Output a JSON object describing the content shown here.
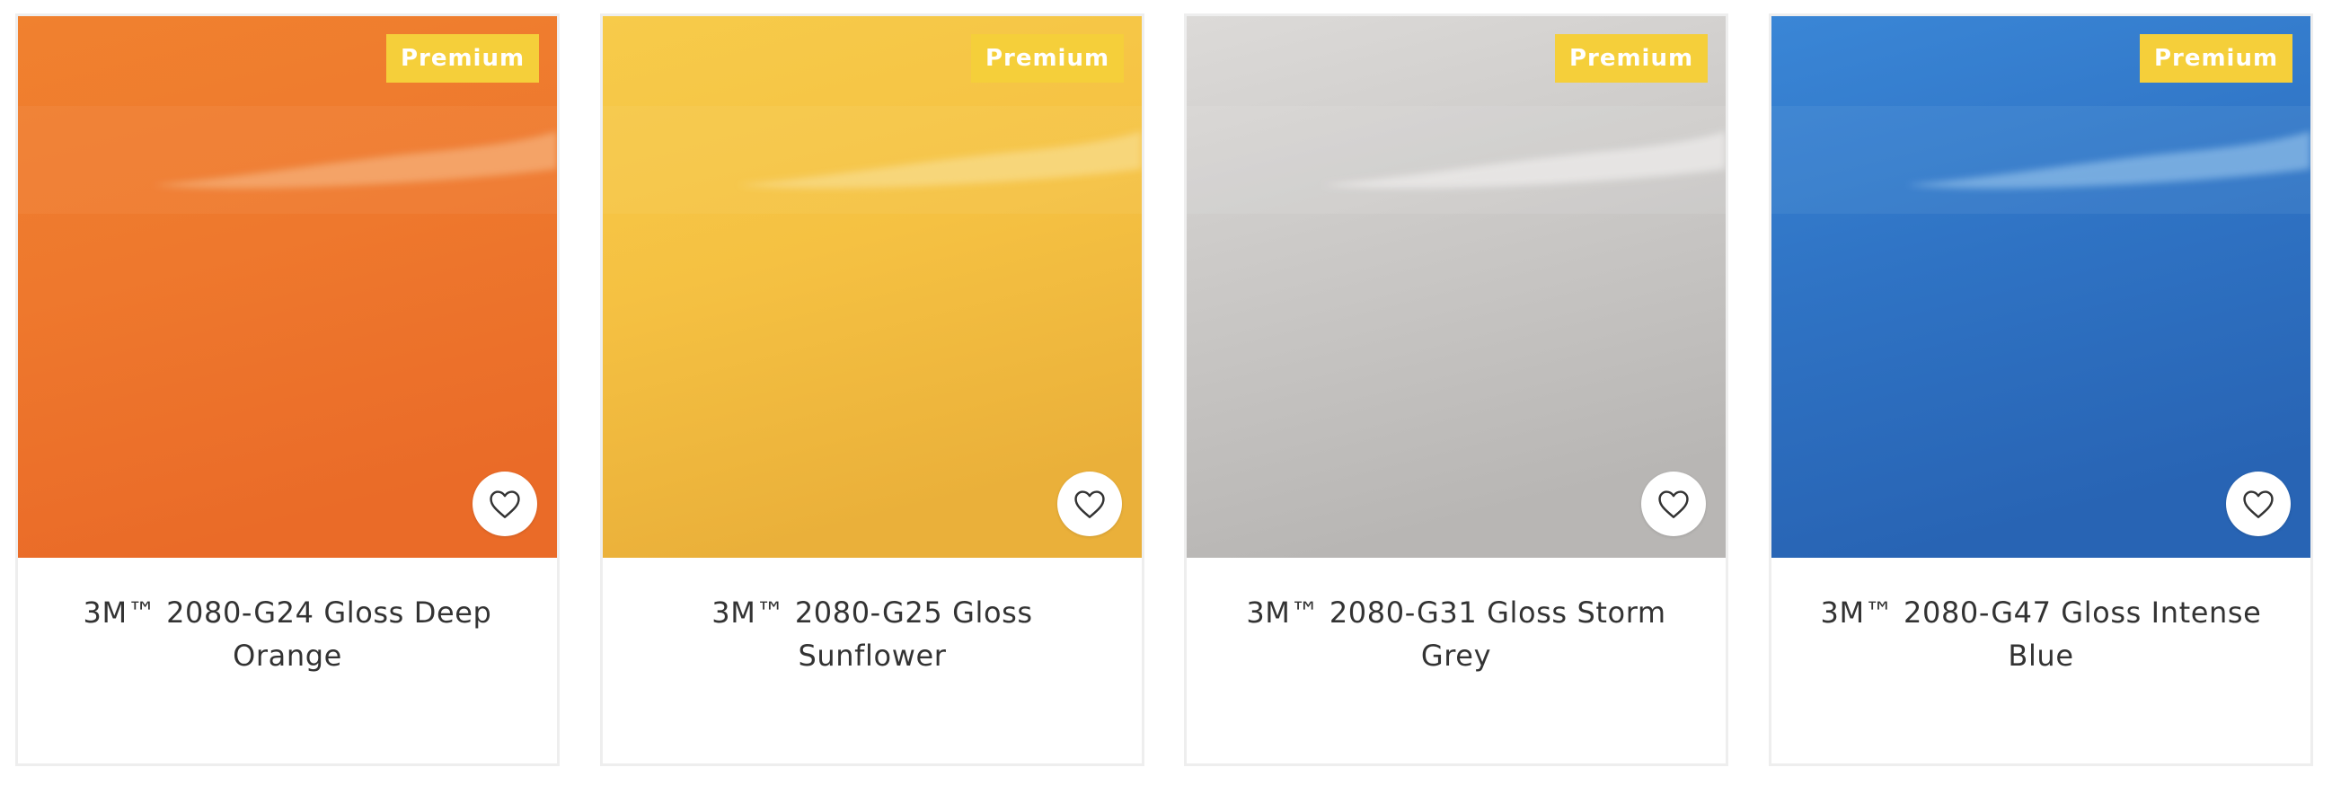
{
  "products": [
    {
      "badge": "Premium",
      "title": "3M™ 2080-G24 Gloss Deep Orange",
      "swatch": {
        "top": "#f0812f",
        "mid": "#ee782d",
        "bottom": "#ea6b28",
        "streak": "#f6b078"
      },
      "favorite_icon": "heart-outline-icon"
    },
    {
      "badge": "Premium",
      "title": "3M™ 2080-G25 Gloss Sunflower",
      "swatch": {
        "top": "#f7cb4a",
        "mid": "#f5c142",
        "bottom": "#eab03a",
        "streak": "#f9dc8a"
      },
      "favorite_icon": "heart-outline-icon"
    },
    {
      "badge": "Premium",
      "title": "3M™ 2080-G31 Gloss Storm Grey",
      "swatch": {
        "top": "#dcdad8",
        "mid": "#cac8c6",
        "bottom": "#b8b6b4",
        "streak": "#eeeceb"
      },
      "favorite_icon": "heart-outline-icon"
    },
    {
      "badge": "Premium",
      "title": "3M™ 2080-G47 Gloss Intense Blue",
      "swatch": {
        "top": "#3a86d6",
        "mid": "#2f73c4",
        "bottom": "#2864b4",
        "streak": "#8bbbe8"
      },
      "favorite_icon": "heart-outline-icon"
    }
  ],
  "colors": {
    "badge_bg": "#f5cf3a",
    "badge_text": "#ffffff",
    "card_border": "#eeeeee",
    "title_text": "#333333"
  }
}
